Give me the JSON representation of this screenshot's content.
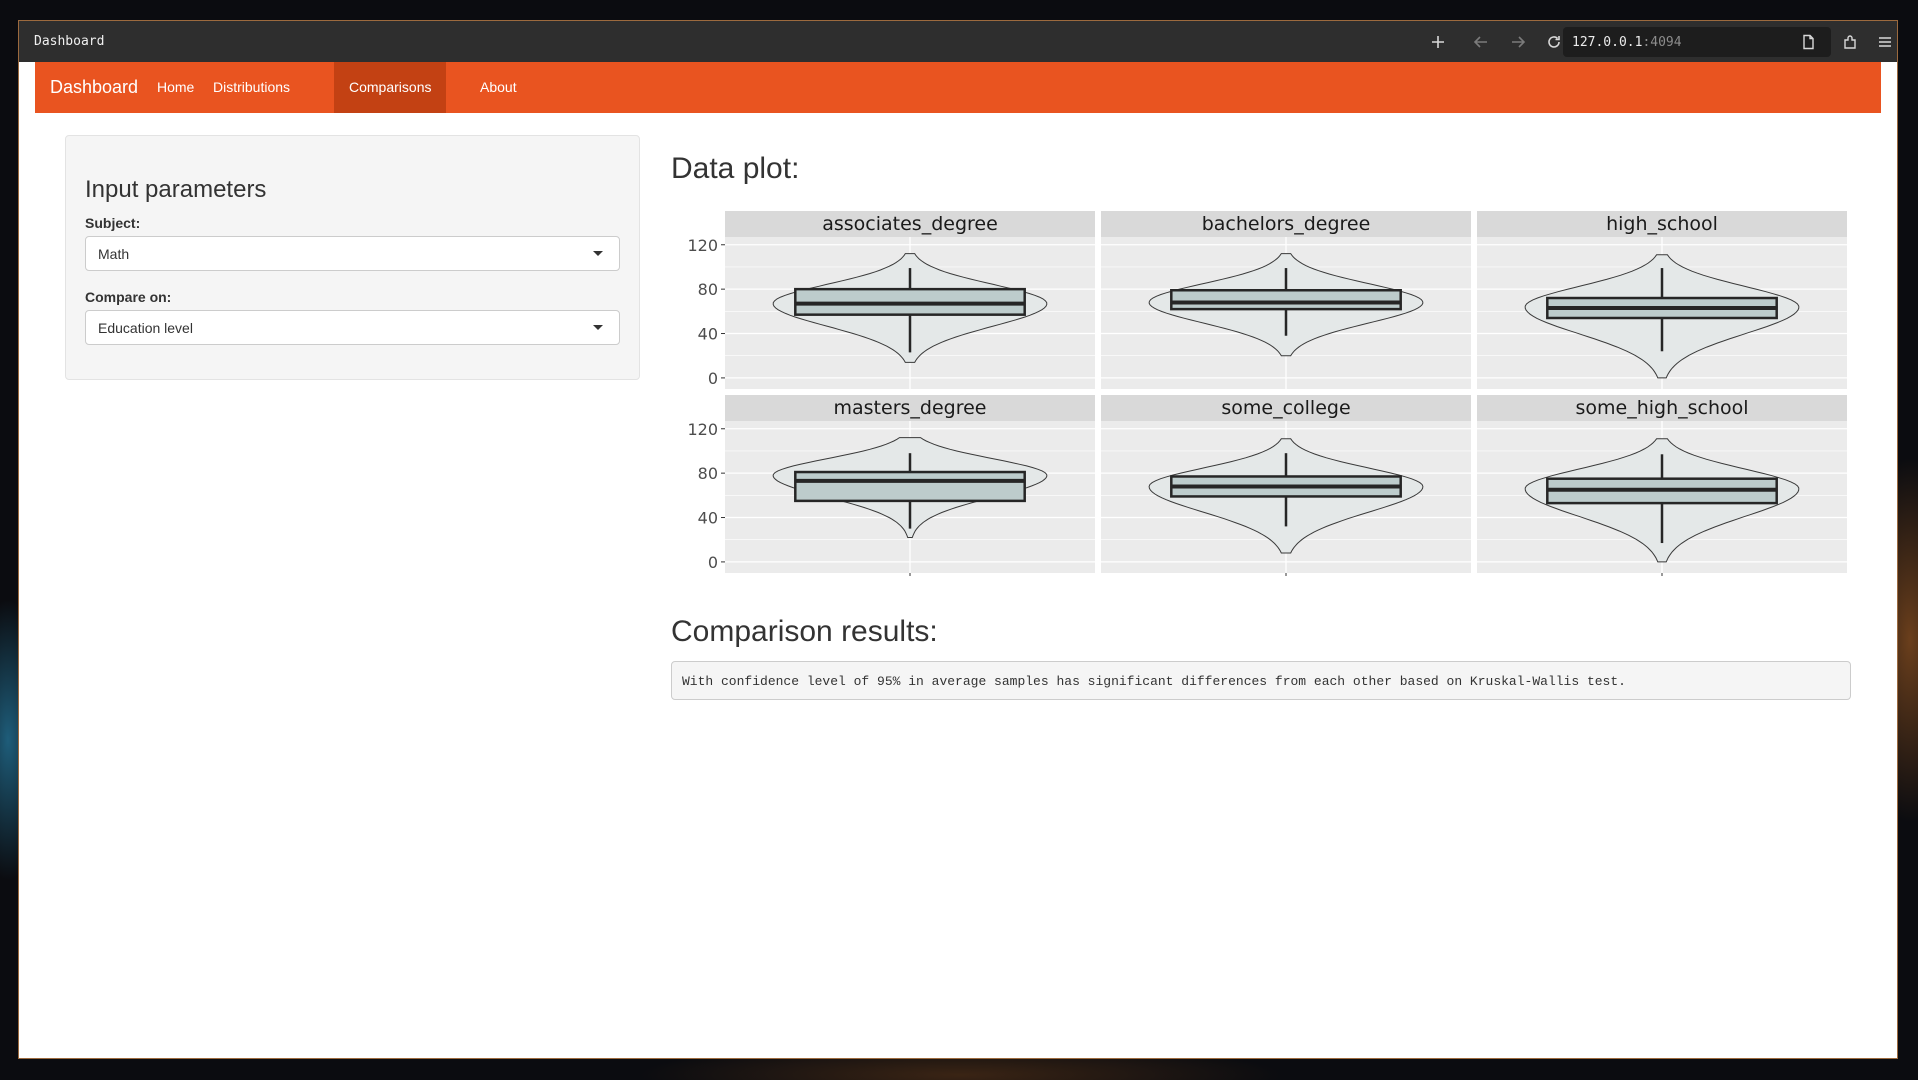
{
  "browser": {
    "tab_title": "Dashboard",
    "url_host": "127.0.0.1",
    "url_port": ":4094",
    "icons": [
      "plus-icon",
      "back-icon",
      "forward-icon",
      "reload-icon",
      "reader-icon",
      "extensions-icon",
      "menu-icon"
    ]
  },
  "navbar": {
    "brand": "Dashboard",
    "items": [
      {
        "label": "Home",
        "active": false
      },
      {
        "label": "Distributions",
        "active": false
      },
      {
        "label": "Comparisons",
        "active": true
      },
      {
        "label": "About",
        "active": false
      }
    ],
    "color": "#e95420",
    "active_color": "#c34113"
  },
  "sidebar": {
    "heading": "Input parameters",
    "subject_label": "Subject:",
    "subject_value": "Math",
    "compare_label": "Compare on:",
    "compare_value": "Education level"
  },
  "main": {
    "plot_heading": "Data plot:",
    "results_heading": "Comparison results:",
    "results_text": "With confidence level of 95% in average samples has significant differences from each other based on Kruskal-Wallis test."
  },
  "chart_data": {
    "type": "violin+box",
    "layout": "facets 2x3",
    "ylim": [
      -10,
      127
    ],
    "yticks": [
      0,
      40,
      80,
      120
    ],
    "grid": true,
    "panels": [
      {
        "name": "associates_degree",
        "min": 14,
        "q1": 57,
        "median": 67,
        "q3": 80,
        "max": 112,
        "whisker_low": 23,
        "whisker_high": 99,
        "violin_peak": 67,
        "violin_width": 0.75
      },
      {
        "name": "bachelors_degree",
        "min": 20,
        "q1": 62,
        "median": 68,
        "q3": 79,
        "max": 112,
        "whisker_low": 38,
        "whisker_high": 99,
        "violin_peak": 68,
        "violin_width": 0.75
      },
      {
        "name": "high_school",
        "min": 0,
        "q1": 54,
        "median": 63,
        "q3": 72,
        "max": 111,
        "whisker_low": 24,
        "whisker_high": 99,
        "violin_peak": 64,
        "violin_width": 0.75
      },
      {
        "name": "masters_degree",
        "min": 22,
        "q1": 55,
        "median": 73,
        "q3": 81,
        "max": 112,
        "whisker_low": 30,
        "whisker_high": 98,
        "violin_peak": 78,
        "violin_width": 0.75
      },
      {
        "name": "some_college",
        "min": 8,
        "q1": 59,
        "median": 68,
        "q3": 77,
        "max": 111,
        "whisker_low": 32,
        "whisker_high": 98,
        "violin_peak": 68,
        "violin_width": 0.75
      },
      {
        "name": "some_high_school",
        "min": 0,
        "q1": 53,
        "median": 65,
        "q3": 75,
        "max": 111,
        "whisker_low": 17,
        "whisker_high": 97,
        "violin_peak": 66,
        "violin_width": 0.75
      }
    ],
    "colors": {
      "panel_bg": "#ebebeb",
      "strip_bg": "#d9d9d9",
      "box_fill": "#bdcccc",
      "violin_fill": "#e4e8e8",
      "stroke": "#262626"
    }
  }
}
